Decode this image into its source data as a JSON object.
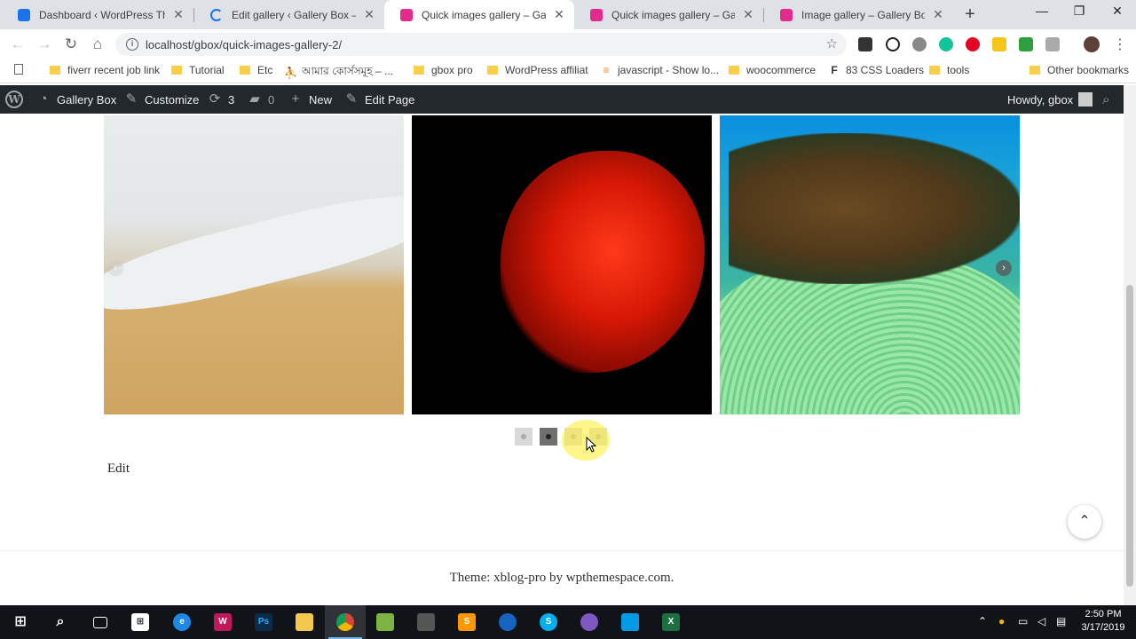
{
  "browser": {
    "tabs": [
      {
        "title": "Dashboard ‹ WordPress Theme",
        "icon": "wordpress-favicon",
        "color": "#1a73e8"
      },
      {
        "title": "Edit gallery ‹ Gallery Box — W",
        "icon": "loading-spinner-icon",
        "color": "#1a73e8"
      },
      {
        "title": "Quick images gallery – Gallery",
        "icon": "gallery-box-favicon",
        "color": "#e22b8d"
      },
      {
        "title": "Quick images gallery – Gallery",
        "icon": "gallery-box-favicon",
        "color": "#e22b8d"
      },
      {
        "title": "Image gallery – Gallery Box",
        "icon": "gallery-box-favicon",
        "color": "#e22b8d"
      }
    ],
    "active_tab": 2,
    "url": "localhost/gbox/quick-images-gallery-2/",
    "bookmarks": [
      {
        "label": "fiverr recent job link",
        "icon": "folder"
      },
      {
        "label": "Tutorial",
        "icon": "folder"
      },
      {
        "label": "Etc",
        "icon": "folder"
      },
      {
        "label": "আমার কোর্সসমূহ – ...",
        "icon": "glyph"
      },
      {
        "label": "gbox pro",
        "icon": "folder"
      },
      {
        "label": "WordPress affiliat",
        "icon": "folder"
      },
      {
        "label": "javascript - Show lo...",
        "icon": "glyph"
      },
      {
        "label": "woocommerce",
        "icon": "folder"
      },
      {
        "label": "83 CSS Loaders",
        "icon": "glyph"
      },
      {
        "label": "tools",
        "icon": "folder"
      },
      {
        "label": "Other bookmarks",
        "icon": "folder"
      }
    ]
  },
  "adminbar": {
    "site_name": "Gallery Box",
    "customize": "Customize",
    "updates_count": "3",
    "comments_count": "0",
    "new_label": "New",
    "edit_page": "Edit Page",
    "howdy": "Howdy, gbox"
  },
  "gallery": {
    "slides": [
      {
        "name": "beach-wave-image"
      },
      {
        "name": "red-betta-fish-image"
      },
      {
        "name": "reef-fish-image"
      }
    ],
    "dots": 4,
    "active_dot": 1,
    "prev_arrow": "‹",
    "next_arrow": "›"
  },
  "page": {
    "edit_link": "Edit",
    "footer": "Theme: xblog-pro by wpthemespace.com."
  },
  "taskbar": {
    "time": "2:50 PM",
    "date": "3/17/2019"
  }
}
